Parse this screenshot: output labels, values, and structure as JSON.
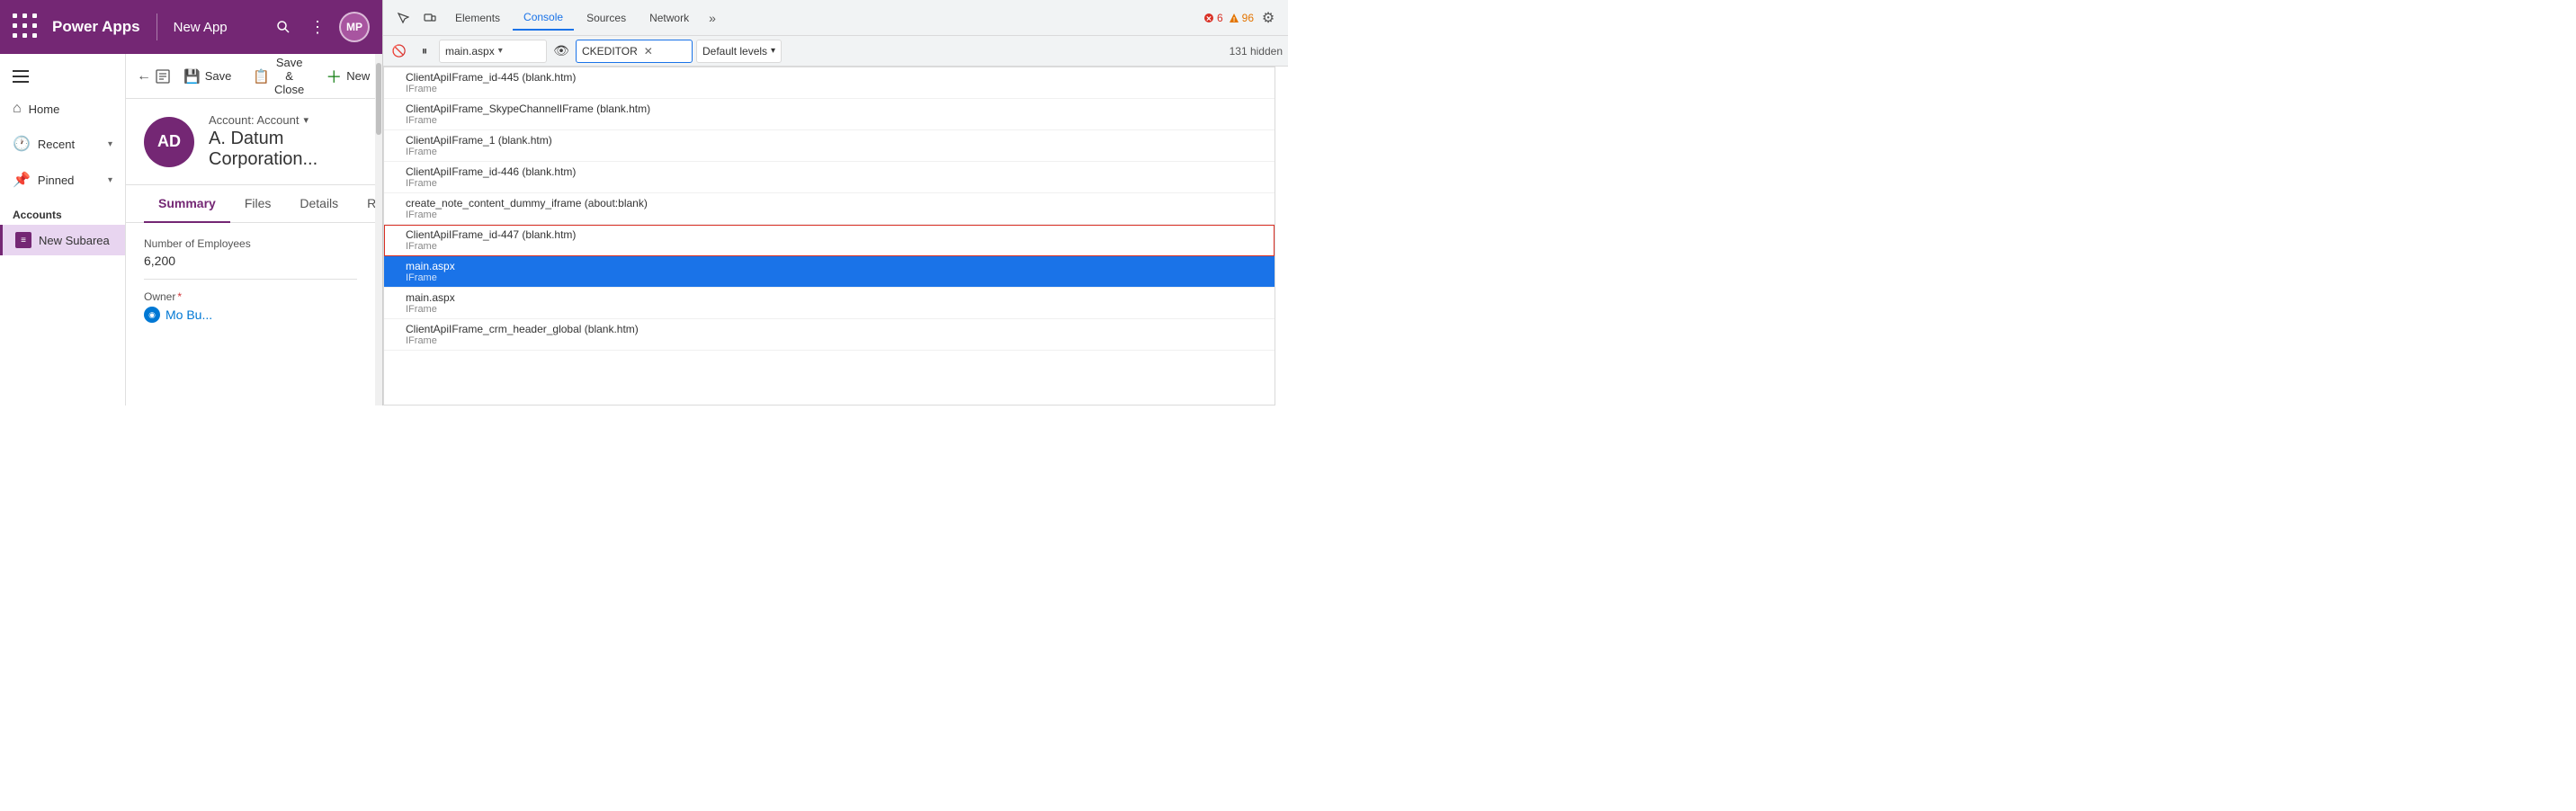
{
  "topbar": {
    "logo": "Power Apps",
    "app_name": "New App",
    "avatar_initials": "MP"
  },
  "sidebar": {
    "home_label": "Home",
    "recent_label": "Recent",
    "pinned_label": "Pinned",
    "section_label": "Accounts",
    "subarea_label": "New Subarea"
  },
  "toolbar": {
    "save_label": "Save",
    "save_close_label": "Save & Close",
    "new_label": "New"
  },
  "record": {
    "avatar_initials": "AD",
    "type_label": "Account: Account",
    "name": "A. Datum Corporation..."
  },
  "tabs": {
    "summary": "Summary",
    "files": "Files",
    "details": "Details",
    "related": "Related"
  },
  "form": {
    "employees_label": "Number of Employees",
    "employees_value": "6,200",
    "owner_label": "Owner",
    "owner_value": "Mo Bu..."
  },
  "devtools": {
    "tabs": [
      "Elements",
      "Console",
      "Sources",
      "Network"
    ],
    "active_tab": "Console",
    "more_label": "»",
    "error_count": "6",
    "warning_count": "96",
    "context_value": "main.aspx",
    "filter_value": "CKEDITOR",
    "level_label": "Default levels",
    "hidden_count": "131 hidden"
  },
  "console_entries": [
    {
      "main": "ClientApiIFrame_id-445 (blank.htm)",
      "sub": "IFrame",
      "state": "normal"
    },
    {
      "main": "ClientApiIFrame_SkypeChannelIFrame (blank.htm)",
      "sub": "IFrame",
      "state": "normal"
    },
    {
      "main": "ClientApiIFrame_1 (blank.htm)",
      "sub": "IFrame",
      "state": "normal"
    },
    {
      "main": "ClientApiIFrame_id-446 (blank.htm)",
      "sub": "IFrame",
      "state": "normal"
    },
    {
      "main": "create_note_content_dummy_iframe (about:blank)",
      "sub": "IFrame",
      "state": "normal"
    },
    {
      "main": "ClientApiIFrame_id-447 (blank.htm)",
      "sub": "IFrame",
      "state": "highlighted"
    },
    {
      "main": "main.aspx",
      "sub": "IFrame",
      "state": "selected"
    },
    {
      "main": "main.aspx",
      "sub": "IFrame",
      "state": "normal"
    },
    {
      "main": "ClientApiIFrame_crm_header_global (blank.htm)",
      "sub": "IFrame",
      "state": "normal"
    }
  ]
}
